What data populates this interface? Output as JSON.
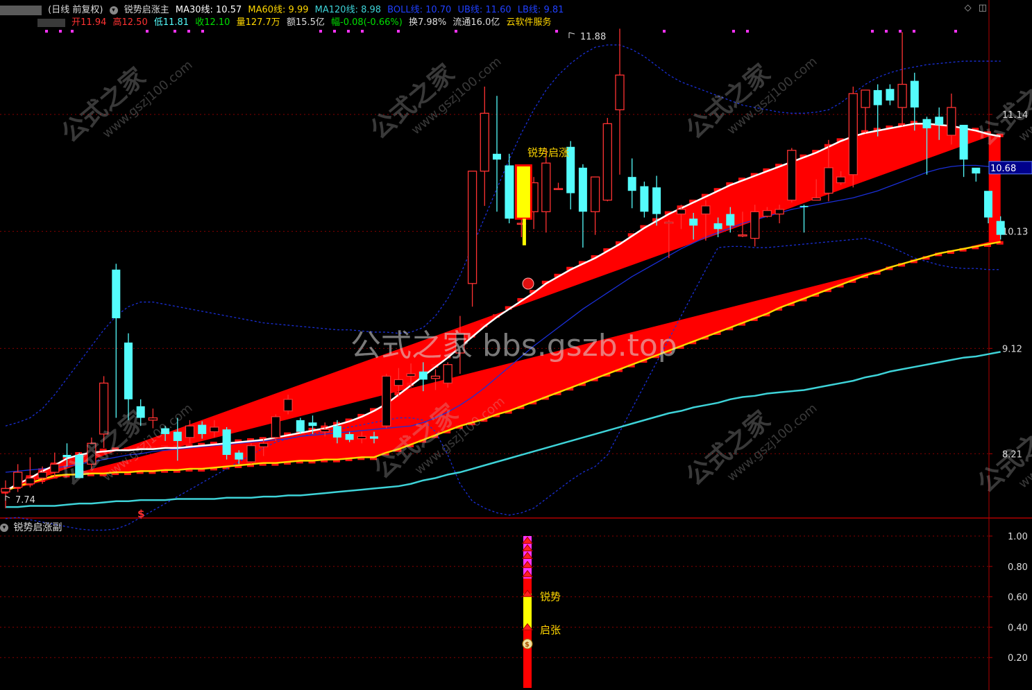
{
  "header": {
    "period": "(日线 前复权)",
    "indicator_name": "锐势启涨主",
    "ma30": "MA30线: 10.57",
    "ma60": "MA60线: 9.99",
    "ma120": "MA120线: 8.98",
    "boll": "BOLL线: 10.70",
    "ub": "UB线: 11.60",
    "lb": "LB线: 9.81"
  },
  "quote": {
    "open": "开11.94",
    "high": "高12.50",
    "low": "低11.81",
    "close": "收12.10",
    "volume": "量127.7万",
    "amount": "额15.5亿",
    "change": "幅-0.08(-0.66%)",
    "turnover": "换7.98%",
    "float": "流通16.0亿",
    "service": "云软件服务"
  },
  "colors": {
    "up": "#ff3232",
    "down": "#54fcfc",
    "ma30": "#1c2fe0",
    "ma60": "#ffd700",
    "ma120": "#3ed3d8",
    "band_fill": "#ff0000",
    "boll": "#1a2fd8",
    "grid": "#8a0000"
  },
  "overlay_labels": {
    "signal_text": "锐势启涨",
    "high_marker": "11.88",
    "low_marker": "7.74",
    "current_price_tag": "10.68",
    "buy_marker": "$"
  },
  "watermarks": {
    "center": "公式之家 bbs.gszb.top",
    "tile_cn": "公式之家",
    "tile_url": "www.gszj100.com"
  },
  "sub_panel": {
    "title": "锐势启涨副",
    "label_ruishi": "锐势",
    "label_qizhang": "启张",
    "coin": "$"
  },
  "chart_data": {
    "type": "candlestick",
    "price_axis": {
      "ticks": [
        "11.14",
        "10.13",
        "9.12",
        "8.21"
      ]
    },
    "sub_axis": {
      "ticks": [
        "1.00",
        "0.80",
        "0.60",
        "0.40",
        "0.20"
      ]
    },
    "candles": [
      [
        7.88,
        7.98,
        7.74,
        7.91
      ],
      [
        7.92,
        8.12,
        7.88,
        8.05
      ],
      [
        7.95,
        8.18,
        7.92,
        8.0
      ],
      [
        8.0,
        8.1,
        7.95,
        8.05
      ],
      [
        8.05,
        8.22,
        8.0,
        8.12
      ],
      [
        8.2,
        8.3,
        8.1,
        8.18
      ],
      [
        8.2,
        8.22,
        8.0,
        8.0
      ],
      [
        8.12,
        8.35,
        8.08,
        8.3
      ],
      [
        8.38,
        8.88,
        8.26,
        8.82
      ],
      [
        9.8,
        9.85,
        8.52,
        9.38
      ],
      [
        9.17,
        9.25,
        8.5,
        8.68
      ],
      [
        8.62,
        8.68,
        8.45,
        8.52
      ],
      [
        8.5,
        8.6,
        8.43,
        8.52
      ],
      [
        8.43,
        8.45,
        8.32,
        8.38
      ],
      [
        8.4,
        8.52,
        8.15,
        8.32
      ],
      [
        8.35,
        8.5,
        8.3,
        8.45
      ],
      [
        8.46,
        8.49,
        8.34,
        8.38
      ],
      [
        8.4,
        8.5,
        8.35,
        8.44
      ],
      [
        8.42,
        8.44,
        8.16,
        8.2
      ],
      [
        8.22,
        8.24,
        8.12,
        8.16
      ],
      [
        8.14,
        8.3,
        8.12,
        8.28
      ],
      [
        8.27,
        8.35,
        8.19,
        8.3
      ],
      [
        8.35,
        8.55,
        8.32,
        8.53
      ],
      [
        8.58,
        8.72,
        8.55,
        8.68
      ],
      [
        8.5,
        8.52,
        8.38,
        8.4
      ],
      [
        8.48,
        8.54,
        8.38,
        8.45
      ],
      [
        8.4,
        8.48,
        8.36,
        8.42
      ],
      [
        8.45,
        8.5,
        8.3,
        8.35
      ],
      [
        8.38,
        8.4,
        8.31,
        8.33
      ],
      [
        8.34,
        8.4,
        8.3,
        8.36
      ],
      [
        8.36,
        8.4,
        8.3,
        8.34
      ],
      [
        8.45,
        8.9,
        8.43,
        8.88
      ],
      [
        8.8,
        8.95,
        8.7,
        8.85
      ],
      [
        8.88,
        8.99,
        8.78,
        8.9
      ],
      [
        8.92,
        9.0,
        8.75,
        8.85
      ],
      [
        8.86,
        8.94,
        8.76,
        8.88
      ],
      [
        8.82,
        9.0,
        8.78,
        8.98
      ],
      [
        9.08,
        9.4,
        8.9,
        9.25
      ],
      [
        9.68,
        9.85,
        9.48,
        10.65
      ],
      [
        10.65,
        11.38,
        10.35,
        11.15
      ],
      [
        10.8,
        11.3,
        10.3,
        10.75
      ],
      [
        10.7,
        10.8,
        10.2,
        10.55
      ],
      [
        10.2,
        10.35,
        10.08,
        10.2
      ],
      [
        10.3,
        10.6,
        10.15,
        10.55
      ],
      [
        10.3,
        10.85,
        10.12,
        10.72
      ],
      [
        10.5,
        10.55,
        10.5,
        10.5
      ],
      [
        10.86,
        10.91,
        10.32,
        10.46
      ],
      [
        10.68,
        10.71,
        9.99,
        10.3
      ],
      [
        10.3,
        10.6,
        10.1,
        10.6
      ],
      [
        10.4,
        11.11,
        10.39,
        11.06
      ],
      [
        11.18,
        11.88,
        10.62,
        11.48
      ],
      [
        10.6,
        10.76,
        10.33,
        10.48
      ],
      [
        10.52,
        10.56,
        10.25,
        10.3
      ],
      [
        10.51,
        10.61,
        10.18,
        10.28
      ],
      [
        10.2,
        10.23,
        9.9,
        10.21
      ],
      [
        10.28,
        10.36,
        10.15,
        10.32
      ],
      [
        10.24,
        10.29,
        10.06,
        10.18
      ],
      [
        10.28,
        10.4,
        10.05,
        10.35
      ],
      [
        10.2,
        10.25,
        10.08,
        10.15
      ],
      [
        10.28,
        10.34,
        10.12,
        10.18
      ],
      [
        10.09,
        10.3,
        10.08,
        10.1
      ],
      [
        10.07,
        10.36,
        10.0,
        10.3
      ],
      [
        10.26,
        10.34,
        10.25,
        10.31
      ],
      [
        10.28,
        10.36,
        10.2,
        10.32
      ],
      [
        10.4,
        10.85,
        10.38,
        10.83
      ],
      [
        10.35,
        10.36,
        10.12,
        10.34
      ],
      [
        10.4,
        10.58,
        10.4,
        10.42
      ],
      [
        10.46,
        10.92,
        10.39,
        10.68
      ],
      [
        10.55,
        10.65,
        10.53,
        10.6
      ],
      [
        10.62,
        11.38,
        10.51,
        11.32
      ],
      [
        11.2,
        11.32,
        10.98,
        11.35
      ],
      [
        11.35,
        11.4,
        10.95,
        11.22
      ],
      [
        11.36,
        11.4,
        11.22,
        11.26
      ],
      [
        11.2,
        11.85,
        11.04,
        11.4
      ],
      [
        11.43,
        11.5,
        11.0,
        11.2
      ],
      [
        11.1,
        11.12,
        10.62,
        11.02
      ],
      [
        11.12,
        11.2,
        10.92,
        11.05
      ],
      [
        10.96,
        11.32,
        10.88,
        11.2
      ],
      [
        11.05,
        10.88,
        10.6,
        10.75
      ],
      [
        10.68,
        10.65,
        10.56,
        10.63
      ],
      [
        10.48,
        10.43,
        10.2,
        10.25
      ],
      [
        10.22,
        10.26,
        10.06,
        10.1
      ]
    ],
    "ma120": [
      7.75,
      7.75,
      7.76,
      7.76,
      7.76,
      7.77,
      7.78,
      7.78,
      7.79,
      7.8,
      7.8,
      7.81,
      7.81,
      7.81,
      7.82,
      7.82,
      7.82,
      7.82,
      7.83,
      7.83,
      7.83,
      7.84,
      7.84,
      7.85,
      7.85,
      7.86,
      7.87,
      7.88,
      7.89,
      7.9,
      7.91,
      7.92,
      7.93,
      7.95,
      7.98,
      8.0,
      8.03,
      8.05,
      8.08,
      8.11,
      8.14,
      8.17,
      8.2,
      8.23,
      8.26,
      8.29,
      8.32,
      8.35,
      8.38,
      8.41,
      8.44,
      8.47,
      8.5,
      8.53,
      8.56,
      8.58,
      8.61,
      8.63,
      8.65,
      8.68,
      8.7,
      8.71,
      8.73,
      8.74,
      8.75,
      8.76,
      8.78,
      8.8,
      8.82,
      8.84,
      8.87,
      8.89,
      8.92,
      8.94,
      8.96,
      8.98,
      9.0,
      9.02,
      9.04,
      9.05,
      9.07,
      9.09
    ],
    "ma60": [
      7.89,
      7.93,
      7.96,
      7.99,
      8.02,
      8.03,
      8.03,
      8.04,
      8.04,
      8.05,
      8.05,
      8.06,
      8.06,
      8.07,
      8.07,
      8.08,
      8.08,
      8.09,
      8.1,
      8.11,
      8.12,
      8.13,
      8.13,
      8.14,
      8.15,
      8.15,
      8.16,
      8.16,
      8.17,
      8.18,
      8.18,
      8.22,
      8.25,
      8.29,
      8.33,
      8.37,
      8.41,
      8.45,
      8.48,
      8.51,
      8.55,
      8.58,
      8.62,
      8.66,
      8.7,
      8.74,
      8.78,
      8.82,
      8.86,
      8.9,
      8.94,
      8.98,
      9.02,
      9.06,
      9.1,
      9.14,
      9.18,
      9.22,
      9.26,
      9.3,
      9.34,
      9.38,
      9.42,
      9.47,
      9.51,
      9.55,
      9.59,
      9.63,
      9.67,
      9.71,
      9.75,
      9.78,
      9.82,
      9.85,
      9.88,
      9.91,
      9.94,
      9.96,
      9.98,
      10.0,
      10.02,
      10.04
    ],
    "ma30": [
      7.89,
      7.95,
      8.0,
      8.06,
      8.11,
      8.17,
      8.2,
      8.22,
      8.23,
      8.24,
      8.24,
      8.25,
      8.25,
      8.26,
      8.26,
      8.27,
      8.28,
      8.29,
      8.3,
      8.31,
      8.32,
      8.33,
      8.35,
      8.37,
      8.39,
      8.41,
      8.43,
      8.46,
      8.49,
      8.53,
      8.58,
      8.64,
      8.72,
      8.8,
      8.88,
      8.96,
      9.04,
      9.13,
      9.22,
      9.31,
      9.39,
      9.46,
      9.53,
      9.6,
      9.68,
      9.74,
      9.8,
      9.85,
      9.9,
      9.96,
      10.02,
      10.09,
      10.16,
      10.22,
      10.28,
      10.33,
      10.38,
      10.43,
      10.48,
      10.53,
      10.57,
      10.61,
      10.65,
      10.69,
      10.73,
      10.77,
      10.81,
      10.86,
      10.91,
      10.95,
      10.98,
      11.0,
      11.02,
      11.04,
      11.06,
      11.06,
      11.05,
      11.04,
      11.02,
      11.0,
      10.97,
      10.95
    ],
    "boll_mid": [
      8.05,
      8.06,
      8.07,
      8.08,
      8.09,
      8.1,
      8.12,
      8.14,
      8.16,
      8.18,
      8.2,
      8.21,
      8.23,
      8.24,
      8.25,
      8.26,
      8.27,
      8.28,
      8.29,
      8.3,
      8.31,
      8.32,
      8.33,
      8.34,
      8.36,
      8.37,
      8.38,
      8.39,
      8.4,
      8.41,
      8.42,
      8.43,
      8.44,
      8.45,
      8.48,
      8.52,
      8.57,
      8.63,
      8.7,
      8.78,
      8.87,
      8.96,
      9.05,
      9.14,
      9.22,
      9.3,
      9.38,
      9.46,
      9.53,
      9.6,
      9.67,
      9.74,
      9.8,
      9.86,
      9.92,
      9.98,
      10.03,
      10.08,
      10.12,
      10.16,
      10.2,
      10.23,
      10.26,
      10.29,
      10.32,
      10.34,
      10.36,
      10.38,
      10.4,
      10.42,
      10.45,
      10.48,
      10.52,
      10.56,
      10.6,
      10.64,
      10.67,
      10.69,
      10.7,
      10.7,
      10.69,
      10.68
    ],
    "ub": [
      8.45,
      8.48,
      8.52,
      8.6,
      8.72,
      8.86,
      9.0,
      9.14,
      9.28,
      9.4,
      9.48,
      9.52,
      9.52,
      9.5,
      9.48,
      9.46,
      9.44,
      9.42,
      9.4,
      9.38,
      9.36,
      9.34,
      9.33,
      9.32,
      9.31,
      9.3,
      9.29,
      9.28,
      9.28,
      9.27,
      9.26,
      9.26,
      9.25,
      9.26,
      9.3,
      9.4,
      9.55,
      9.75,
      10.0,
      10.25,
      10.5,
      10.75,
      10.98,
      11.18,
      11.35,
      11.48,
      11.58,
      11.66,
      11.72,
      11.74,
      11.74,
      11.7,
      11.64,
      11.56,
      11.48,
      11.42,
      11.38,
      11.34,
      11.3,
      11.26,
      11.22,
      11.2,
      11.18,
      11.16,
      11.15,
      11.15,
      11.16,
      11.18,
      11.24,
      11.32,
      11.4,
      11.46,
      11.5,
      11.53,
      11.55,
      11.57,
      11.58,
      11.59,
      11.6,
      11.6,
      11.6,
      11.6
    ],
    "lb": [
      7.65,
      7.66,
      7.64,
      7.62,
      7.6,
      7.58,
      7.56,
      7.55,
      7.55,
      7.56,
      7.6,
      7.66,
      7.72,
      7.78,
      7.84,
      7.9,
      7.96,
      8.02,
      8.08,
      8.14,
      8.2,
      8.26,
      8.31,
      8.34,
      8.36,
      8.38,
      8.4,
      8.42,
      8.44,
      8.46,
      8.48,
      8.5,
      8.52,
      8.52,
      8.5,
      8.4,
      8.2,
      7.95,
      7.8,
      7.74,
      7.7,
      7.68,
      7.7,
      7.74,
      7.82,
      7.9,
      7.98,
      8.05,
      8.1,
      8.2,
      8.4,
      8.6,
      8.8,
      9.0,
      9.2,
      9.4,
      9.6,
      9.8,
      9.99,
      10.0,
      10.0,
      9.99,
      9.99,
      10.0,
      10.01,
      10.02,
      10.03,
      10.04,
      10.05,
      10.06,
      10.07,
      10.04,
      10.0,
      9.95,
      9.9,
      9.87,
      9.84,
      9.82,
      9.81,
      9.81,
      9.8,
      9.8
    ],
    "sub_values": {
      "bar_bottom": 0.0,
      "bar_top": 1.0,
      "yellow_from": 0.38,
      "yellow_to": 0.62,
      "ruishi_level": 0.6,
      "qizhang_level": 0.4
    }
  }
}
